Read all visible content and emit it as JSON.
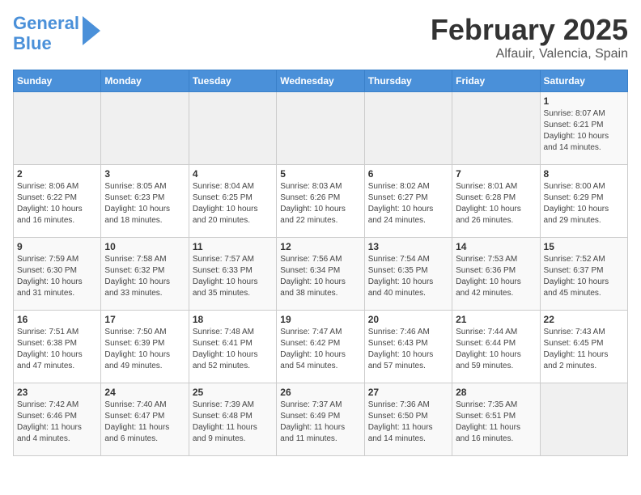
{
  "header": {
    "logo_line1": "General",
    "logo_line2": "Blue",
    "month": "February 2025",
    "location": "Alfauir, Valencia, Spain"
  },
  "days_of_week": [
    "Sunday",
    "Monday",
    "Tuesday",
    "Wednesday",
    "Thursday",
    "Friday",
    "Saturday"
  ],
  "weeks": [
    [
      {
        "day": "",
        "info": ""
      },
      {
        "day": "",
        "info": ""
      },
      {
        "day": "",
        "info": ""
      },
      {
        "day": "",
        "info": ""
      },
      {
        "day": "",
        "info": ""
      },
      {
        "day": "",
        "info": ""
      },
      {
        "day": "1",
        "info": "Sunrise: 8:07 AM\nSunset: 6:21 PM\nDaylight: 10 hours\nand 14 minutes."
      }
    ],
    [
      {
        "day": "2",
        "info": "Sunrise: 8:06 AM\nSunset: 6:22 PM\nDaylight: 10 hours\nand 16 minutes."
      },
      {
        "day": "3",
        "info": "Sunrise: 8:05 AM\nSunset: 6:23 PM\nDaylight: 10 hours\nand 18 minutes."
      },
      {
        "day": "4",
        "info": "Sunrise: 8:04 AM\nSunset: 6:25 PM\nDaylight: 10 hours\nand 20 minutes."
      },
      {
        "day": "5",
        "info": "Sunrise: 8:03 AM\nSunset: 6:26 PM\nDaylight: 10 hours\nand 22 minutes."
      },
      {
        "day": "6",
        "info": "Sunrise: 8:02 AM\nSunset: 6:27 PM\nDaylight: 10 hours\nand 24 minutes."
      },
      {
        "day": "7",
        "info": "Sunrise: 8:01 AM\nSunset: 6:28 PM\nDaylight: 10 hours\nand 26 minutes."
      },
      {
        "day": "8",
        "info": "Sunrise: 8:00 AM\nSunset: 6:29 PM\nDaylight: 10 hours\nand 29 minutes."
      }
    ],
    [
      {
        "day": "9",
        "info": "Sunrise: 7:59 AM\nSunset: 6:30 PM\nDaylight: 10 hours\nand 31 minutes."
      },
      {
        "day": "10",
        "info": "Sunrise: 7:58 AM\nSunset: 6:32 PM\nDaylight: 10 hours\nand 33 minutes."
      },
      {
        "day": "11",
        "info": "Sunrise: 7:57 AM\nSunset: 6:33 PM\nDaylight: 10 hours\nand 35 minutes."
      },
      {
        "day": "12",
        "info": "Sunrise: 7:56 AM\nSunset: 6:34 PM\nDaylight: 10 hours\nand 38 minutes."
      },
      {
        "day": "13",
        "info": "Sunrise: 7:54 AM\nSunset: 6:35 PM\nDaylight: 10 hours\nand 40 minutes."
      },
      {
        "day": "14",
        "info": "Sunrise: 7:53 AM\nSunset: 6:36 PM\nDaylight: 10 hours\nand 42 minutes."
      },
      {
        "day": "15",
        "info": "Sunrise: 7:52 AM\nSunset: 6:37 PM\nDaylight: 10 hours\nand 45 minutes."
      }
    ],
    [
      {
        "day": "16",
        "info": "Sunrise: 7:51 AM\nSunset: 6:38 PM\nDaylight: 10 hours\nand 47 minutes."
      },
      {
        "day": "17",
        "info": "Sunrise: 7:50 AM\nSunset: 6:39 PM\nDaylight: 10 hours\nand 49 minutes."
      },
      {
        "day": "18",
        "info": "Sunrise: 7:48 AM\nSunset: 6:41 PM\nDaylight: 10 hours\nand 52 minutes."
      },
      {
        "day": "19",
        "info": "Sunrise: 7:47 AM\nSunset: 6:42 PM\nDaylight: 10 hours\nand 54 minutes."
      },
      {
        "day": "20",
        "info": "Sunrise: 7:46 AM\nSunset: 6:43 PM\nDaylight: 10 hours\nand 57 minutes."
      },
      {
        "day": "21",
        "info": "Sunrise: 7:44 AM\nSunset: 6:44 PM\nDaylight: 10 hours\nand 59 minutes."
      },
      {
        "day": "22",
        "info": "Sunrise: 7:43 AM\nSunset: 6:45 PM\nDaylight: 11 hours\nand 2 minutes."
      }
    ],
    [
      {
        "day": "23",
        "info": "Sunrise: 7:42 AM\nSunset: 6:46 PM\nDaylight: 11 hours\nand 4 minutes."
      },
      {
        "day": "24",
        "info": "Sunrise: 7:40 AM\nSunset: 6:47 PM\nDaylight: 11 hours\nand 6 minutes."
      },
      {
        "day": "25",
        "info": "Sunrise: 7:39 AM\nSunset: 6:48 PM\nDaylight: 11 hours\nand 9 minutes."
      },
      {
        "day": "26",
        "info": "Sunrise: 7:37 AM\nSunset: 6:49 PM\nDaylight: 11 hours\nand 11 minutes."
      },
      {
        "day": "27",
        "info": "Sunrise: 7:36 AM\nSunset: 6:50 PM\nDaylight: 11 hours\nand 14 minutes."
      },
      {
        "day": "28",
        "info": "Sunrise: 7:35 AM\nSunset: 6:51 PM\nDaylight: 11 hours\nand 16 minutes."
      },
      {
        "day": "",
        "info": ""
      }
    ]
  ]
}
